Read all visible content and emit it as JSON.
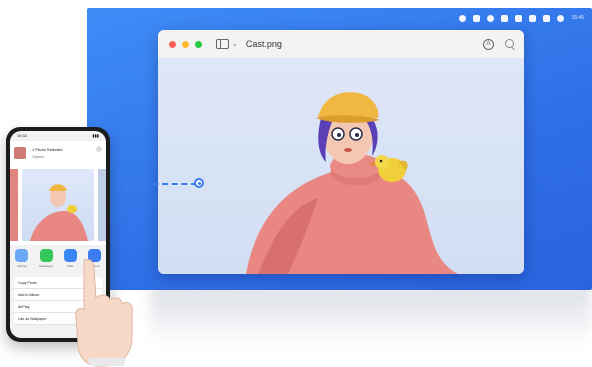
{
  "menubar": {
    "icons": [
      "record-icon",
      "volume-icon",
      "contrast-icon",
      "user-icon",
      "battery-icon",
      "display-icon",
      "network-icon",
      "wifi-icon"
    ],
    "time": "15:45"
  },
  "preview_window": {
    "title": "Cast.png",
    "traffic_lights": [
      "close",
      "minimize",
      "zoom"
    ]
  },
  "phone": {
    "status_time": "15:32",
    "share_title": "1 Photo Selected",
    "share_subtitle": "Options",
    "apps": [
      {
        "label": "AirDrop",
        "color": "#6aa8f5",
        "icon": "airdrop-icon"
      },
      {
        "label": "Messages",
        "color": "#34c759",
        "icon": "messages-icon"
      },
      {
        "label": "Mail",
        "color": "#3a86f5",
        "icon": "mail-icon"
      },
      {
        "label": "Wireless",
        "color": "#3b7cf0",
        "icon": "cast-icon"
      }
    ],
    "actions": [
      "Copy Photo",
      "Add to Album",
      "AirPlay",
      "Use as Wallpaper"
    ]
  },
  "colors": {
    "desktop": "#3f8cf7",
    "connector": "#3b7cf0"
  }
}
